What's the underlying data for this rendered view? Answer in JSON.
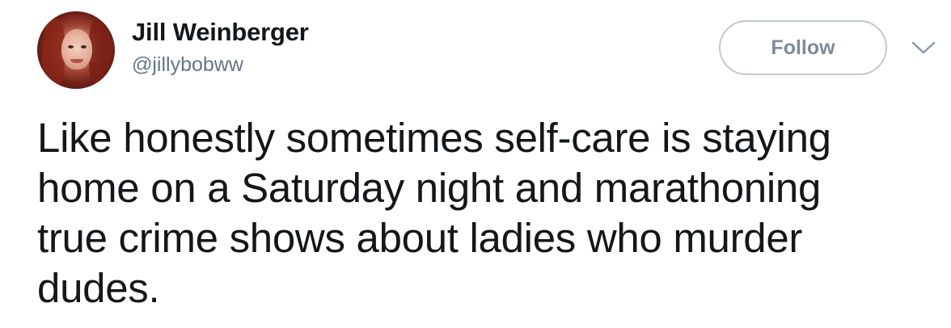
{
  "author": {
    "display_name": "Jill Weinberger",
    "handle": "@jillybobww",
    "avatar_icon": "user-avatar-photo"
  },
  "actions": {
    "follow_label": "Follow",
    "menu_icon": "chevron-down-icon"
  },
  "tweet": {
    "text_lines": [
      "Like honestly sometimes self-care is staying",
      "home on a Saturday night and marathoning",
      "true crime shows about ladies who murder",
      "dudes."
    ]
  },
  "colors": {
    "text_primary": "#14171a",
    "text_secondary": "#657786",
    "button_border": "#bfc9d1",
    "button_text": "#7d8b96"
  }
}
